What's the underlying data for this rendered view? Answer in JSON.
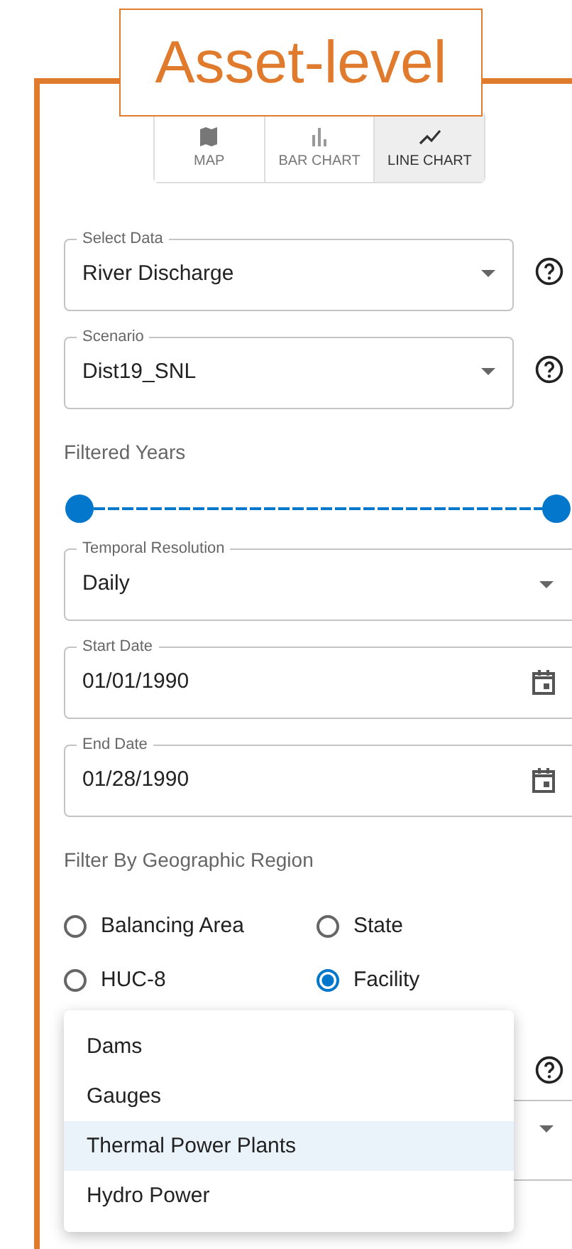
{
  "title": "Asset-level",
  "view_tabs": [
    {
      "label": "MAP",
      "kind": "map",
      "selected": false
    },
    {
      "label": "BAR CHART",
      "kind": "bar",
      "selected": false
    },
    {
      "label": "LINE CHART",
      "kind": "line",
      "selected": true
    }
  ],
  "select_data": {
    "label": "Select Data",
    "value": "River Discharge"
  },
  "scenario": {
    "label": "Scenario",
    "value": "Dist19_SNL"
  },
  "filtered_years": {
    "label": "Filtered Years",
    "thumbs": [
      {
        "level": 0
      },
      {
        "level": 1
      }
    ]
  },
  "temporal_resolution": {
    "label": "Temporal Resolution",
    "value": "Daily"
  },
  "start_date": {
    "label": "Start Date",
    "value": "01/01/1990"
  },
  "end_date": {
    "label": "End Date",
    "value": "01/28/1990"
  },
  "region_filter": {
    "label": "Filter By Geographic Region",
    "options": [
      {
        "label": "Balancing Area",
        "selected": false
      },
      {
        "label": "State",
        "selected": false
      },
      {
        "label": "HUC-8",
        "selected": false
      },
      {
        "label": "Facility",
        "selected": true
      }
    ]
  },
  "facility_menu": {
    "items": [
      {
        "label": "Dams",
        "selected": false
      },
      {
        "label": "Gauges",
        "selected": false
      },
      {
        "label": "Thermal Power Plants",
        "selected": true
      },
      {
        "label": "Hydro Power",
        "selected": false
      }
    ]
  }
}
